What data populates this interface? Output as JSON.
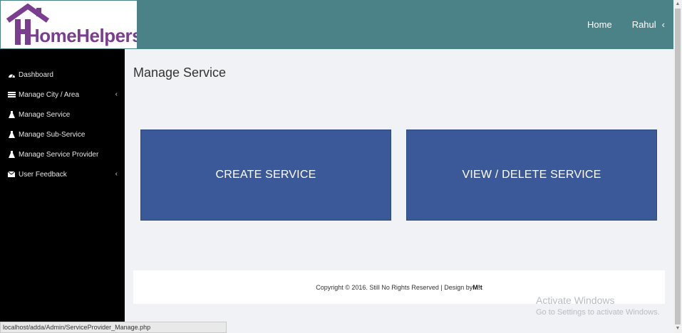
{
  "header": {
    "logo_text": "HomeHelpers",
    "nav": {
      "home": "Home",
      "user": "Rahul"
    }
  },
  "sidebar": {
    "items": [
      {
        "label": "Dashboard",
        "icon": "dashboard-icon"
      },
      {
        "label": "Manage City / Area",
        "icon": "list-icon"
      },
      {
        "label": "Manage Service",
        "icon": "flask-icon"
      },
      {
        "label": "Manage Sub-Service",
        "icon": "flask-icon"
      },
      {
        "label": "Manage Service Provider",
        "icon": "flask-icon"
      },
      {
        "label": "User Feedback",
        "icon": "envelope-icon"
      }
    ]
  },
  "main": {
    "title": "Manage Service",
    "tiles": {
      "create": "CREATE SERVICE",
      "view": "VIEW / DELETE SERVICE"
    }
  },
  "footer": {
    "text": "Copyright © 2016. Still No Rights Reserved | Design by ",
    "designer": "M!t"
  },
  "watermark": {
    "title": "Activate Windows",
    "subtitle": "Go to Settings to activate Windows."
  },
  "statusbar": {
    "url": "localhost/adda/Admin/ServiceProvider_Manage.php"
  },
  "colors": {
    "header": "#4a8288",
    "sidebar": "#000000",
    "tile": "#3b5998",
    "logo": "#7a3d8f"
  }
}
